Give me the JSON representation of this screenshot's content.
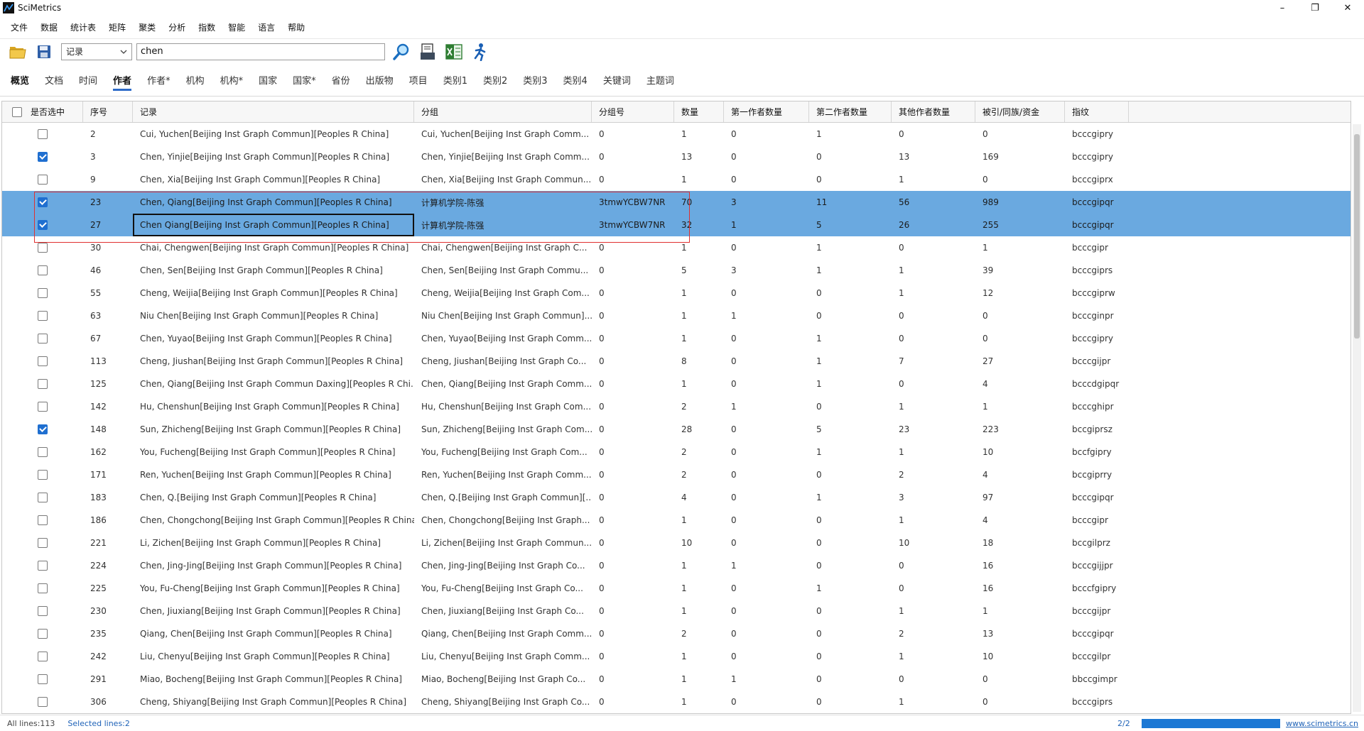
{
  "window": {
    "title": "SciMetrics",
    "minimize": "–",
    "restore": "❐",
    "close": "✕"
  },
  "menu": [
    "文件",
    "数据",
    "统计表",
    "矩阵",
    "聚类",
    "分析",
    "指数",
    "智能",
    "语言",
    "帮助"
  ],
  "toolbar": {
    "select_value": "记录",
    "search_value": "chen"
  },
  "tabs": [
    "概览",
    "文档",
    "时间",
    "作者",
    "作者*",
    "机构",
    "机构*",
    "国家",
    "国家*",
    "省份",
    "出版物",
    "项目",
    "类别1",
    "类别2",
    "类别3",
    "类别4",
    "关键词",
    "主题词"
  ],
  "active_tab": 3,
  "table": {
    "headers": [
      "是否选中",
      "序号",
      "记录",
      "分组",
      "分组号",
      "数量",
      "第一作者数量",
      "第二作者数量",
      "其他作者数量",
      "被引/同族/资金",
      "指纹"
    ],
    "rows": [
      {
        "checked": false,
        "selected": false,
        "cells": [
          "2",
          "Cui, Yuchen[Beijing Inst Graph Commun][Peoples R China]",
          "Cui, Yuchen[Beijing Inst Graph Comm...",
          "0",
          "1",
          "0",
          "1",
          "0",
          "0",
          "bcccgipry"
        ]
      },
      {
        "checked": true,
        "selected": false,
        "cells": [
          "3",
          "Chen, Yinjie[Beijing Inst Graph Commun][Peoples R China]",
          "Chen, Yinjie[Beijing Inst Graph Comm...",
          "0",
          "13",
          "0",
          "0",
          "13",
          "169",
          "bcccgipry"
        ]
      },
      {
        "checked": false,
        "selected": false,
        "cells": [
          "9",
          "Chen, Xia[Beijing Inst Graph Commun][Peoples R China]",
          "Chen, Xia[Beijing Inst Graph Commun...",
          "0",
          "1",
          "0",
          "0",
          "1",
          "0",
          "bcccgiprx"
        ]
      },
      {
        "checked": true,
        "selected": true,
        "cells": [
          "23",
          "Chen, Qiang[Beijing Inst Graph Commun][Peoples R China]",
          "计算机学院-陈强",
          "3tmwYCBW7NR",
          "70",
          "3",
          "11",
          "56",
          "989",
          "bcccgipqr"
        ]
      },
      {
        "checked": true,
        "selected": true,
        "focus": true,
        "cells": [
          "27",
          "Chen Qiang[Beijing Inst Graph Commun][Peoples R China]",
          "计算机学院-陈强",
          "3tmwYCBW7NR",
          "32",
          "1",
          "5",
          "26",
          "255",
          "bcccgipqr"
        ]
      },
      {
        "checked": false,
        "selected": false,
        "cells": [
          "30",
          "Chai, Chengwen[Beijing Inst Graph Commun][Peoples R China]",
          "Chai, Chengwen[Beijing Inst Graph C...",
          "0",
          "1",
          "0",
          "1",
          "0",
          "1",
          "bcccgipr"
        ]
      },
      {
        "checked": false,
        "selected": false,
        "cells": [
          "46",
          "Chen, Sen[Beijing Inst Graph Commun][Peoples R China]",
          "Chen, Sen[Beijing Inst Graph Commu...",
          "0",
          "5",
          "3",
          "1",
          "1",
          "39",
          "bcccgiprs"
        ]
      },
      {
        "checked": false,
        "selected": false,
        "cells": [
          "55",
          "Cheng, Weijia[Beijing Inst Graph Commun][Peoples R China]",
          "Cheng, Weijia[Beijing Inst Graph Com...",
          "0",
          "1",
          "0",
          "0",
          "1",
          "12",
          "bcccgiprw"
        ]
      },
      {
        "checked": false,
        "selected": false,
        "cells": [
          "63",
          "Niu Chen[Beijing Inst Graph Commun][Peoples R China]",
          "Niu Chen[Beijing Inst Graph Commun]...",
          "0",
          "1",
          "1",
          "0",
          "0",
          "0",
          "bcccginpr"
        ]
      },
      {
        "checked": false,
        "selected": false,
        "cells": [
          "67",
          "Chen, Yuyao[Beijing Inst Graph Commun][Peoples R China]",
          "Chen, Yuyao[Beijing Inst Graph Comm...",
          "0",
          "1",
          "0",
          "1",
          "0",
          "0",
          "bcccgipry"
        ]
      },
      {
        "checked": false,
        "selected": false,
        "cells": [
          "113",
          "Cheng, Jiushan[Beijing Inst Graph Commun][Peoples R China]",
          "Cheng, Jiushan[Beijing Inst Graph Co...",
          "0",
          "8",
          "0",
          "1",
          "7",
          "27",
          "bcccgijpr"
        ]
      },
      {
        "checked": false,
        "selected": false,
        "cells": [
          "125",
          "Chen, Qiang[Beijing Inst Graph Commun Daxing][Peoples R Chi...",
          "Chen, Qiang[Beijing Inst Graph Comm...",
          "0",
          "1",
          "0",
          "1",
          "0",
          "4",
          "bcccdgipqr"
        ]
      },
      {
        "checked": false,
        "selected": false,
        "cells": [
          "142",
          "Hu, Chenshun[Beijing Inst Graph Commun][Peoples R China]",
          "Hu, Chenshun[Beijing Inst Graph Com...",
          "0",
          "2",
          "1",
          "0",
          "1",
          "1",
          "bcccghipr"
        ]
      },
      {
        "checked": true,
        "selected": false,
        "cells": [
          "148",
          "Sun, Zhicheng[Beijing Inst Graph Commun][Peoples R China]",
          "Sun, Zhicheng[Beijing Inst Graph Com...",
          "0",
          "28",
          "0",
          "5",
          "23",
          "223",
          "bccgiprsz"
        ]
      },
      {
        "checked": false,
        "selected": false,
        "cells": [
          "162",
          "You, Fucheng[Beijing Inst Graph Commun][Peoples R China]",
          "You, Fucheng[Beijing Inst Graph Com...",
          "0",
          "2",
          "0",
          "1",
          "1",
          "10",
          "bccfgipry"
        ]
      },
      {
        "checked": false,
        "selected": false,
        "cells": [
          "171",
          "Ren, Yuchen[Beijing Inst Graph Commun][Peoples R China]",
          "Ren, Yuchen[Beijing Inst Graph Comm...",
          "0",
          "2",
          "0",
          "0",
          "2",
          "4",
          "bccgiprry"
        ]
      },
      {
        "checked": false,
        "selected": false,
        "cells": [
          "183",
          "Chen, Q.[Beijing Inst Graph Commun][Peoples R China]",
          "Chen, Q.[Beijing Inst Graph Commun][...",
          "0",
          "4",
          "0",
          "1",
          "3",
          "97",
          "bcccgipqr"
        ]
      },
      {
        "checked": false,
        "selected": false,
        "cells": [
          "186",
          "Chen, Chongchong[Beijing Inst Graph Commun][Peoples R China]",
          "Chen, Chongchong[Beijing Inst Graph...",
          "0",
          "1",
          "0",
          "0",
          "1",
          "4",
          "bcccgipr"
        ]
      },
      {
        "checked": false,
        "selected": false,
        "cells": [
          "221",
          "Li, Zichen[Beijing Inst Graph Commun][Peoples R China]",
          "Li, Zichen[Beijing Inst Graph Commun...",
          "0",
          "10",
          "0",
          "0",
          "10",
          "18",
          "bccgilprz"
        ]
      },
      {
        "checked": false,
        "selected": false,
        "cells": [
          "224",
          "Chen, Jing-Jing[Beijing Inst Graph Commun][Peoples R China]",
          "Chen, Jing-Jing[Beijing Inst Graph Co...",
          "0",
          "1",
          "1",
          "0",
          "0",
          "16",
          "bcccgijjpr"
        ]
      },
      {
        "checked": false,
        "selected": false,
        "cells": [
          "225",
          "You, Fu-Cheng[Beijing Inst Graph Commun][Peoples R China]",
          "You, Fu-Cheng[Beijing Inst Graph Co...",
          "0",
          "1",
          "0",
          "1",
          "0",
          "16",
          "bcccfgipry"
        ]
      },
      {
        "checked": false,
        "selected": false,
        "cells": [
          "230",
          "Chen, Jiuxiang[Beijing Inst Graph Commun][Peoples R China]",
          "Chen, Jiuxiang[Beijing Inst Graph Co...",
          "0",
          "1",
          "0",
          "0",
          "1",
          "1",
          "bcccgijpr"
        ]
      },
      {
        "checked": false,
        "selected": false,
        "cells": [
          "235",
          "Qiang, Chen[Beijing Inst Graph Commun][Peoples R China]",
          "Qiang, Chen[Beijing Inst Graph Comm...",
          "0",
          "2",
          "0",
          "0",
          "2",
          "13",
          "bcccgipqr"
        ]
      },
      {
        "checked": false,
        "selected": false,
        "cells": [
          "242",
          "Liu, Chenyu[Beijing Inst Graph Commun][Peoples R China]",
          "Liu, Chenyu[Beijing Inst Graph Comm...",
          "0",
          "1",
          "0",
          "0",
          "1",
          "10",
          "bcccgilpr"
        ]
      },
      {
        "checked": false,
        "selected": false,
        "cells": [
          "291",
          "Miao, Bocheng[Beijing Inst Graph Commun][Peoples R China]",
          "Miao, Bocheng[Beijing Inst Graph Co...",
          "0",
          "1",
          "1",
          "0",
          "0",
          "0",
          "bbccgimpr"
        ]
      },
      {
        "checked": false,
        "selected": false,
        "cells": [
          "306",
          "Cheng, Shiyang[Beijing Inst Graph Commun][Peoples R China]",
          "Cheng, Shiyang[Beijing Inst Graph Co...",
          "0",
          "1",
          "0",
          "0",
          "1",
          "0",
          "bcccgiprs"
        ]
      }
    ]
  },
  "status": {
    "all_lines": "All lines:113",
    "selected_lines": "Selected lines:2",
    "page": "2/2",
    "progress": 1.0,
    "link": "www.scimetrics.cn"
  },
  "colors": {
    "selected_row": "#6aa9e0",
    "accent": "#1f6fd0",
    "annotation": "#e03030"
  },
  "icons": [
    "open-folder-icon",
    "save-icon",
    "search-icon",
    "report-icon",
    "excel-icon",
    "runner-icon"
  ]
}
